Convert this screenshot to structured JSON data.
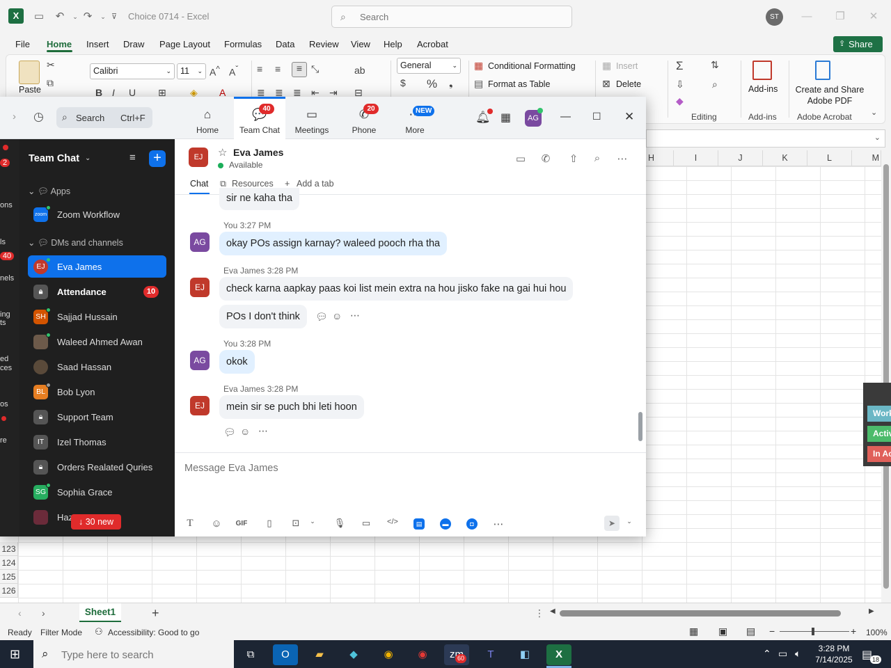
{
  "excel": {
    "doc_title": "Choice 0714  -  Excel",
    "search_placeholder": "Search",
    "user_initials": "ST",
    "menu": [
      "File",
      "Home",
      "Insert",
      "Draw",
      "Page Layout",
      "Formulas",
      "Data",
      "Review",
      "View",
      "Help",
      "Acrobat"
    ],
    "share_label": "Share",
    "ribbon": {
      "paste": "Paste",
      "font_name": "Calibri",
      "font_size": "11",
      "number_format": "General",
      "conditional_formatting": "Conditional Formatting",
      "format_as_table": "Format as Table",
      "insert": "Insert",
      "delete": "Delete",
      "editing": "Editing",
      "addins_button": "Add-ins",
      "addins_group": "Add-ins",
      "create_share_pdf": "Create and Share Adobe PDF",
      "adobe_group": "Adobe Acrobat"
    },
    "columns": [
      "H",
      "I",
      "J",
      "K",
      "L",
      "M"
    ],
    "rows": [
      "123",
      "124",
      "125",
      "126"
    ],
    "sheet_tab": "Sheet1",
    "status": {
      "ready": "Ready",
      "filter_mode": "Filter Mode",
      "accessibility": "Accessibility: Good to go",
      "zoom": "100%"
    },
    "side_panel": [
      "Work",
      "Activ",
      "In Ac"
    ],
    "side_panel_colors": [
      "#6bb7c5",
      "#4cbb6b",
      "#e0605a"
    ]
  },
  "zoom": {
    "search_label": "Search",
    "search_shortcut": "Ctrl+F",
    "tabs": [
      {
        "label": "Home",
        "badge": ""
      },
      {
        "label": "Team Chat",
        "badge": "40"
      },
      {
        "label": "Meetings",
        "badge": ""
      },
      {
        "label": "Phone",
        "badge": "20"
      },
      {
        "label": "More",
        "badge": "NEW"
      }
    ],
    "my_initials": "AG",
    "left_strip": [
      "2",
      "ons",
      "ls",
      "40",
      "nels",
      "ing",
      "ts",
      "ed",
      "ces",
      "os",
      "re"
    ],
    "sidebar": {
      "title": "Team Chat",
      "section_apps": "Apps",
      "zoom_workflow": "Zoom Workflow",
      "section_dms": "DMs and channels",
      "items": [
        {
          "initials": "EJ",
          "label": "Eva James",
          "color": "#c0392b"
        },
        {
          "initials": "",
          "label": "Attendance",
          "color": "#555555",
          "unread": "10"
        },
        {
          "initials": "SH",
          "label": "Sajjad Hussain",
          "color": "#d35400"
        },
        {
          "initials": "",
          "label": "Waleed Ahmed Awan",
          "color": "#6d5a4a"
        },
        {
          "initials": "",
          "label": "Saad Hassan",
          "color": "#5a4a3a"
        },
        {
          "initials": "BL",
          "label": "Bob Lyon",
          "color": "#e67e22"
        },
        {
          "initials": "",
          "label": "Support Team",
          "color": "#555555"
        },
        {
          "initials": "IT",
          "label": "Izel Thomas",
          "color": "#555555"
        },
        {
          "initials": "",
          "label": "Orders Realated Quries",
          "color": "#555555"
        },
        {
          "initials": "SG",
          "label": "Sophia Grace",
          "color": "#27ae60"
        },
        {
          "initials": "",
          "label": "Haz",
          "color": "#6b2b3a"
        }
      ],
      "new_messages": "↓ 30 new"
    },
    "chat": {
      "contact_initials": "EJ",
      "contact_name": "Eva James",
      "contact_status": "Available",
      "tabs": [
        "Chat",
        "Resources",
        "Add a tab"
      ],
      "messages": [
        {
          "meta": "",
          "text": "sir ne kaha tha",
          "mine": false
        },
        {
          "meta": "You 3:27 PM",
          "text": "okay POs assign karnay? waleed pooch rha tha",
          "mine": true
        },
        {
          "meta": "Eva James 3:28 PM",
          "text": "check karna aapkay paas koi list mein extra na hou jisko fake na gai hui hou",
          "mine": false
        },
        {
          "meta": "",
          "text": "POs I don't think",
          "mine": false
        },
        {
          "meta": "You 3:28 PM",
          "text": "okok",
          "mine": true
        },
        {
          "meta": "Eva James 3:28 PM",
          "text": "mein sir se puch bhi leti hoon",
          "mine": false
        }
      ],
      "composer_placeholder": "Message Eva James",
      "gif_label": "GIF"
    }
  },
  "taskbar": {
    "search_placeholder": "Type here to search",
    "time": "3:28 PM",
    "date": "7/14/2025",
    "notification_count": "18",
    "zoom_badge": "60"
  }
}
